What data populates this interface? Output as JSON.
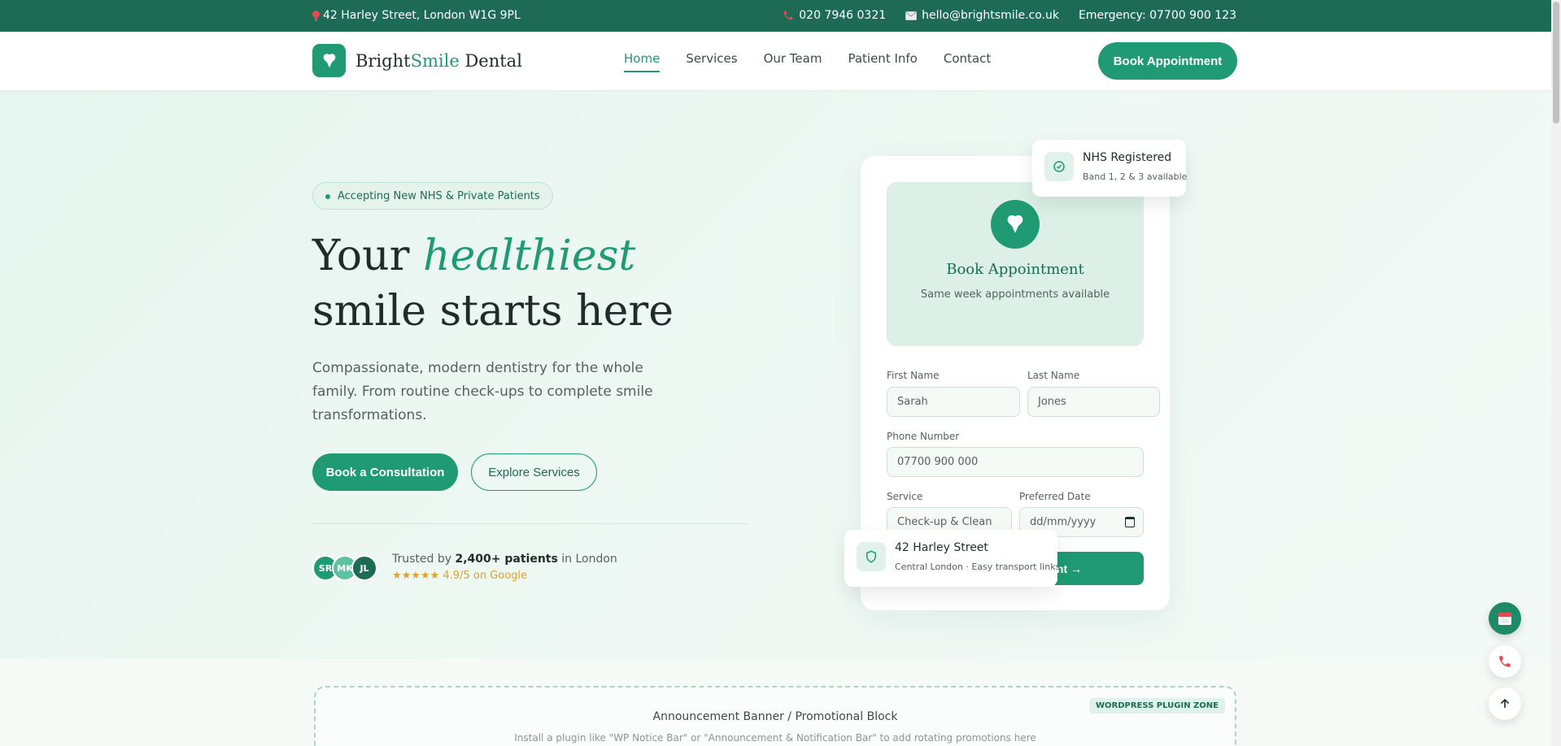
{
  "topbar": {
    "address": "42 Harley Street, London W1G 9PL",
    "phone": "020 7946 0321",
    "email": "hello@brightsmile.co.uk",
    "emergency": "Emergency: 07700 900 123"
  },
  "header": {
    "brand_part1": "Bright",
    "brand_part2": "Smile",
    "brand_part3": " Dental",
    "nav": [
      {
        "label": "Home"
      },
      {
        "label": "Services"
      },
      {
        "label": "Our Team"
      },
      {
        "label": "Patient Info"
      },
      {
        "label": "Contact"
      }
    ],
    "cta": "Book Appointment"
  },
  "hero": {
    "badge": "Accepting New NHS & Private Patients",
    "title_line1_a": "Your ",
    "title_line1_b": "healthiest",
    "title_line2": "smile starts here",
    "subtitle": "Compassionate, modern dentistry for the whole family. From routine check-ups to complete smile transformations.",
    "btn_primary": "Book a Consultation",
    "btn_secondary": "Explore Services",
    "avatars": [
      "SR",
      "MK",
      "JL"
    ],
    "trust_prefix": "Trusted by ",
    "trust_count": "2,400+ patients",
    "trust_suffix": " in London",
    "rating": "★★★★★ 4.9/5 on Google"
  },
  "card": {
    "title": "Book Appointment",
    "description": "Same week appointments available",
    "first_name_label": "First Name",
    "first_name_value": "Sarah",
    "last_name_label": "Last Name",
    "last_name_value": "Jones",
    "phone_label": "Phone Number",
    "phone_value": "07700 900 000",
    "service_label": "Service",
    "service_value": "Check-up & Clean",
    "date_label": "Preferred Date",
    "date_value": "dd/mm/yyyy",
    "submit": "nt →"
  },
  "float_nhs": {
    "title": "NHS Registered",
    "subtitle": "Band 1, 2 & 3 available"
  },
  "float_location": {
    "title": "42 Harley Street",
    "subtitle": "Central London · Easy transport links"
  },
  "plugin": {
    "tag": "WORDPRESS PLUGIN ZONE",
    "title": "Announcement Banner / Promotional Block",
    "description": "Install a plugin like \"WP Notice Bar\" or \"Announcement & Notification Bar\" to add rotating promotions here"
  },
  "colors": {
    "brand_dark": "#1e6b55",
    "brand": "#1f9a72",
    "star": "#e0a02a"
  }
}
